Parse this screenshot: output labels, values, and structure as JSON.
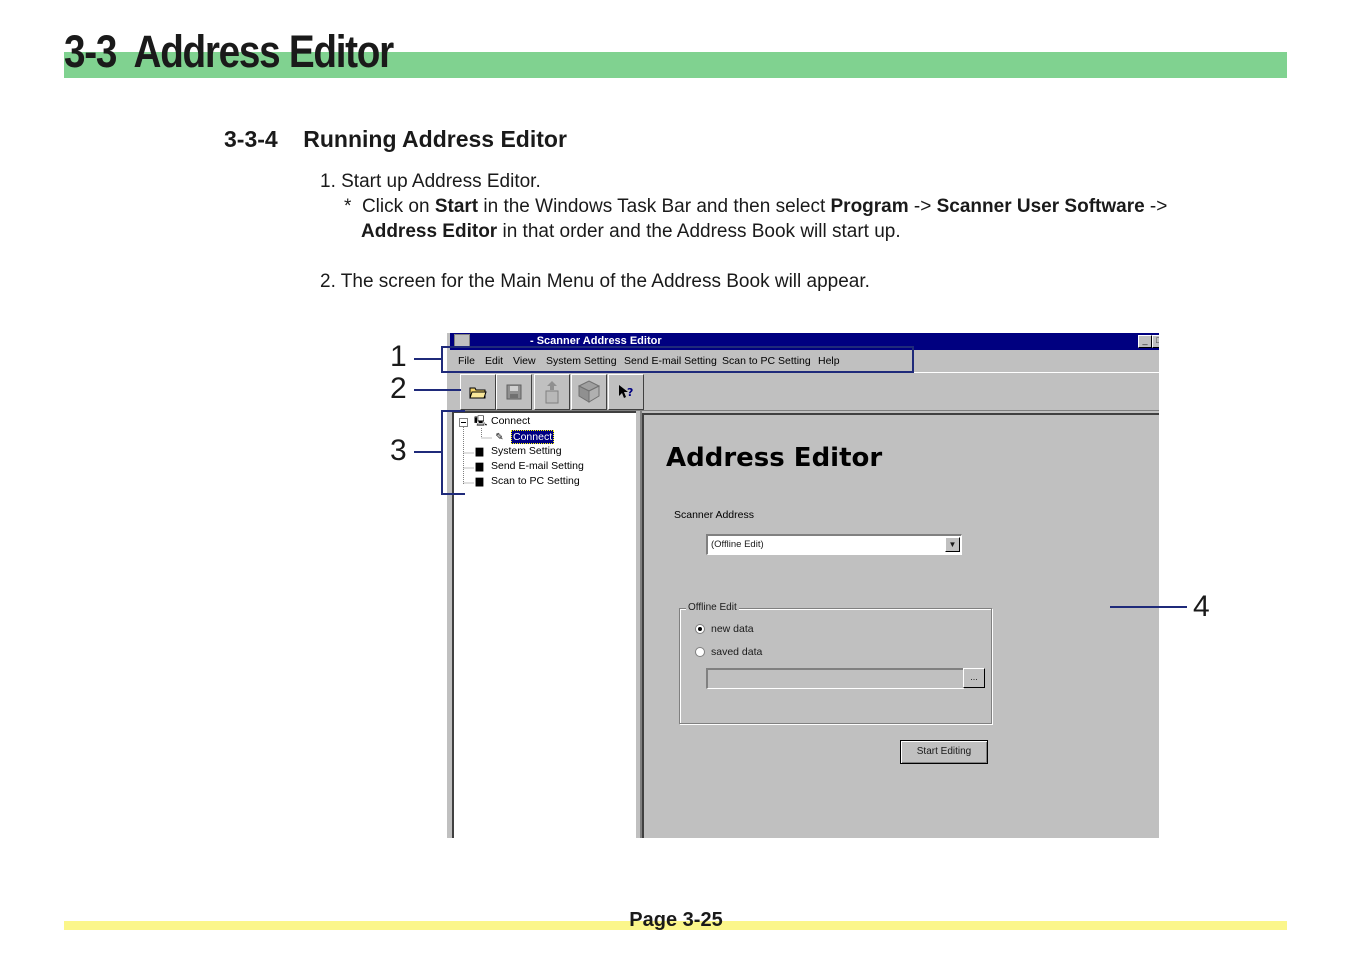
{
  "header": {
    "title": "3-3  Address Editor"
  },
  "section": {
    "title": "3-3-4    Running Address Editor"
  },
  "steps": {
    "s1": "1. Start up Address Editor.",
    "s1_note_a": "*  Click on ",
    "s1_start": "Start",
    "s1_note_b": " in the Windows Task Bar and then select ",
    "s1_program": "Program",
    "s1_arrow1": " -> ",
    "s1_sus": "Scanner User Software",
    "s1_arrow2": " ->",
    "s1_ae": "Address Editor",
    "s1_note_c": " in that order and the Address Book will start up.",
    "s2": "2. The screen for the Main Menu of the Address Book will appear."
  },
  "app": {
    "window_title": "- Scanner Address Editor",
    "menu": [
      "File",
      "Edit",
      "View",
      "System Setting",
      "Send E-mail Setting",
      "Scan to PC Setting",
      "Help"
    ],
    "toolbar_icons": [
      "open-folder-icon",
      "save-disk-icon",
      "export-icon",
      "scanner-icon",
      "help-cursor-icon"
    ],
    "tree": [
      {
        "label": "Connect",
        "icon": "computer-icon",
        "level": 0
      },
      {
        "label": "Connect",
        "icon": "edit-icon",
        "level": 1,
        "selected": true
      },
      {
        "label": "System Setting",
        "icon": "folder-icon",
        "level": 0
      },
      {
        "label": "Send E-mail Setting",
        "icon": "folder-icon",
        "level": 0
      },
      {
        "label": "Scan to PC Setting",
        "icon": "folder-icon",
        "level": 0
      }
    ],
    "pane_title": "Address Editor",
    "scanner_address_label": "Scanner Address",
    "scanner_address_value": "(Offline Edit)",
    "group_label": "Offline Edit",
    "radio_new": "new data",
    "radio_saved": "saved data",
    "browse_label": "...",
    "start_button": "Start Editing"
  },
  "callouts": {
    "c1": "1",
    "c2": "2",
    "c3": "3",
    "c4": "4"
  },
  "footer": {
    "page": "Page 3-25"
  },
  "colors": {
    "header_bar": "#80d290",
    "footer_bar": "#fbf68a",
    "callout": "#1f2a7a",
    "titlebar": "#000080"
  }
}
